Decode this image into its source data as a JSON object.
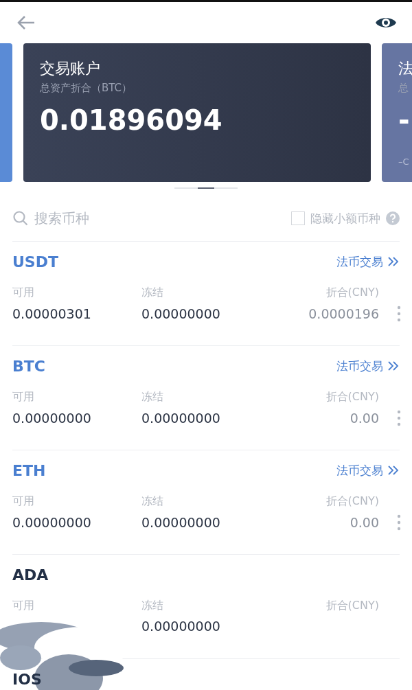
{
  "cards": [
    {
      "kind": "left"
    },
    {
      "kind": "main",
      "title": "交易账户",
      "subtitle": "总资产折合（BTC）",
      "value": "0.01896094"
    },
    {
      "kind": "right",
      "title": "法",
      "subtitle": "总",
      "value": "-",
      "note": "–C"
    }
  ],
  "search": {
    "placeholder": "搜索币种"
  },
  "hide_small": {
    "label": "隐藏小额币种",
    "checked": false
  },
  "assets": [
    {
      "name": "USDT",
      "trade_link": "法币交易",
      "labels": [
        "可用",
        "冻结",
        "折合(CNY)"
      ],
      "available": "0.00000301",
      "frozen": "0.00000000",
      "cny": "0.0000196",
      "redacted": false
    },
    {
      "name": "BTC",
      "trade_link": "法币交易",
      "labels": [
        "可用",
        "冻结",
        "折合(CNY)"
      ],
      "available": "0.00000000",
      "frozen": "0.00000000",
      "cny": "0.00",
      "redacted": false
    },
    {
      "name": "ETH",
      "trade_link": "法币交易",
      "labels": [
        "可用",
        "冻结",
        "折合(CNY)"
      ],
      "available": "0.00000000",
      "frozen": "0.00000000",
      "cny": "0.00",
      "redacted": false
    },
    {
      "name": "ADA",
      "labels": [
        "可用",
        "冻结",
        "折合(CNY)"
      ],
      "frozen": "0.00000000",
      "redacted": true
    },
    {
      "name": "IOS",
      "redacted": false
    }
  ]
}
